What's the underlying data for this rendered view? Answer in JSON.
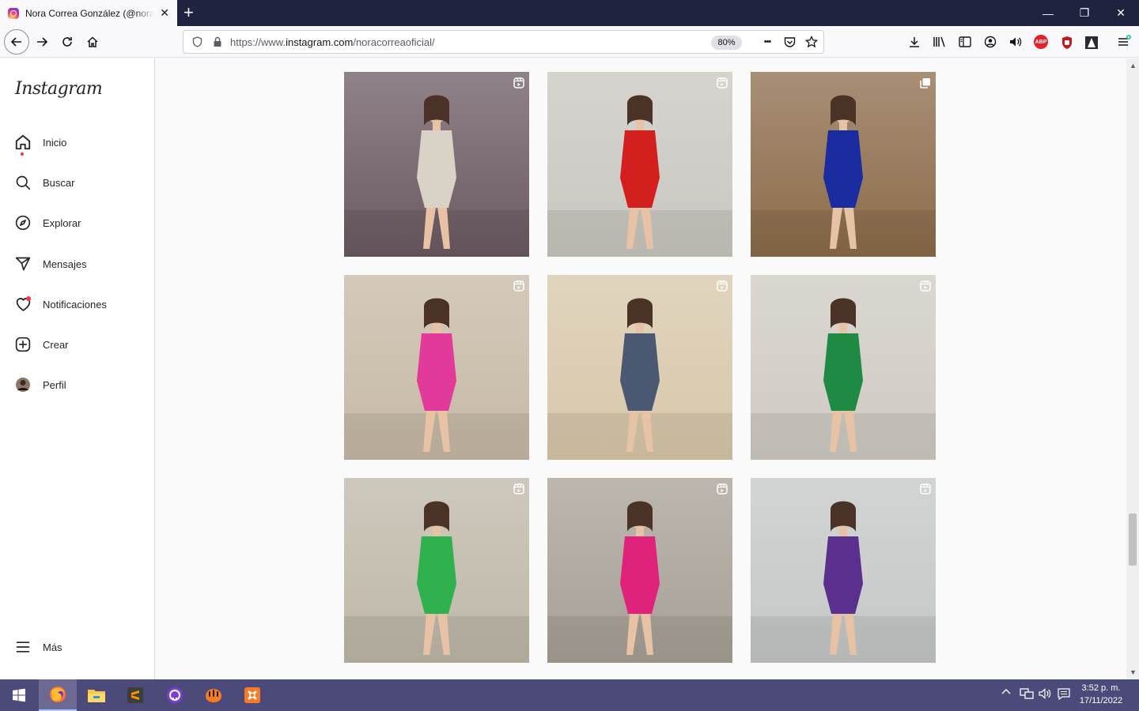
{
  "browser": {
    "tab_title": "Nora Correa González (@noracorreaoficial)",
    "tab_close": "✕",
    "new_tab": "+",
    "url_prefix": "https://www.",
    "url_host": "instagram.com",
    "url_path": "/noracorreaoficial/",
    "zoom": "80%",
    "page_actions": "•••",
    "window_controls": {
      "minimize": "—",
      "restore": "❐",
      "close": "✕"
    },
    "extensions": {
      "abp": "ABP"
    }
  },
  "instagram": {
    "logo": "Instagram",
    "menu": [
      {
        "id": "home",
        "label": "Inicio",
        "icon": "home-icon"
      },
      {
        "id": "search",
        "label": "Buscar",
        "icon": "search-icon"
      },
      {
        "id": "explore",
        "label": "Explorar",
        "icon": "compass-icon"
      },
      {
        "id": "messages",
        "label": "Mensajes",
        "icon": "paper-plane-icon"
      },
      {
        "id": "notifications",
        "label": "Notificaciones",
        "icon": "heart-icon"
      },
      {
        "id": "create",
        "label": "Crear",
        "icon": "plus-square-icon"
      },
      {
        "id": "profile",
        "label": "Perfil",
        "icon": "avatar"
      }
    ],
    "more_label": "Más",
    "posts": [
      {
        "type": "reel",
        "icon": "reel-icon",
        "bg": "#6b5a62",
        "dress": "#d9d2c6"
      },
      {
        "type": "reel",
        "icon": "reel-icon",
        "bg": "#c9c7c0",
        "dress": "#d41f1f"
      },
      {
        "type": "post",
        "icon": "carousel-icon",
        "bg": "#8c6b4a",
        "dress": "#1a2ca0"
      },
      {
        "type": "reel",
        "icon": "reel-icon",
        "bg": "#c7b9a5",
        "dress": "#e23a9a"
      },
      {
        "type": "reel",
        "icon": "reel-icon",
        "bg": "#d8c8aa",
        "dress": "#4b5872"
      },
      {
        "type": "reel",
        "icon": "reel-icon",
        "bg": "#cfcbc3",
        "dress": "#1e8a43"
      },
      {
        "type": "reel",
        "icon": "reel-icon",
        "bg": "#bfb8a8",
        "dress": "#2fb14e"
      },
      {
        "type": "reel",
        "icon": "reel-icon",
        "bg": "#a7a096",
        "dress": "#e0237a"
      },
      {
        "type": "reel",
        "icon": "reel-icon",
        "bg": "#c5c8c7",
        "dress": "#5a2f8e"
      }
    ]
  },
  "taskbar": {
    "apps": [
      "windows-start-icon",
      "firefox-icon",
      "file-explorer-icon",
      "sublime-text-icon",
      "github-desktop-icon",
      "jetbrains-toolbox-icon",
      "xampp-icon"
    ],
    "time": "3:52 p. m.",
    "date": "17/11/2022"
  }
}
